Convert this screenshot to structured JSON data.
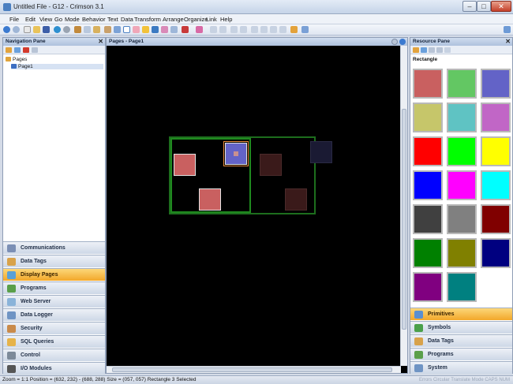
{
  "window": {
    "title": "Untitled File - G12 - Crimson 3.1"
  },
  "menu": [
    "File",
    "Edit",
    "View",
    "Go",
    "Mode",
    "Behavior",
    "Text",
    "Data",
    "Transform",
    "Arrange",
    "Organize",
    "Link",
    "Help"
  ],
  "nav_pane": {
    "title": "Navigation Pane",
    "tree": {
      "root": "Pages",
      "child": "Page1"
    },
    "categories": [
      "Communications",
      "Data Tags",
      "Display Pages",
      "Programs",
      "Web Server",
      "Data Logger",
      "Security",
      "SQL Queries",
      "Control",
      "I/O Modules"
    ],
    "active_category": "Display Pages"
  },
  "page_pane": {
    "title": "Pages - Page1"
  },
  "resource_pane": {
    "title": "Resource Pane",
    "subtitle": "Rectangle",
    "swatch_colors": [
      "#c96060",
      "#63c763",
      "#6363c7",
      "#c6c66a",
      "#5fc3c3",
      "#c166c6",
      "#ff0000",
      "#00ff00",
      "#ffff00",
      "#0000ff",
      "#ff00ff",
      "#00ffff",
      "#404040",
      "#808080",
      "#800000",
      "#008000",
      "#808000",
      "#000080",
      "#800080",
      "#008080"
    ],
    "categories": [
      "Primitives",
      "Symbols",
      "Data Tags",
      "Programs",
      "System"
    ],
    "active_category": "Primitives"
  },
  "status": {
    "text": "Zoom = 1:1  Position = (632, 232) - (688, 288)  Size = (057, 057)  Rectangle 3 Selected",
    "right": "Errors  Circular  Translate  Mode  CAPS  NUM"
  }
}
